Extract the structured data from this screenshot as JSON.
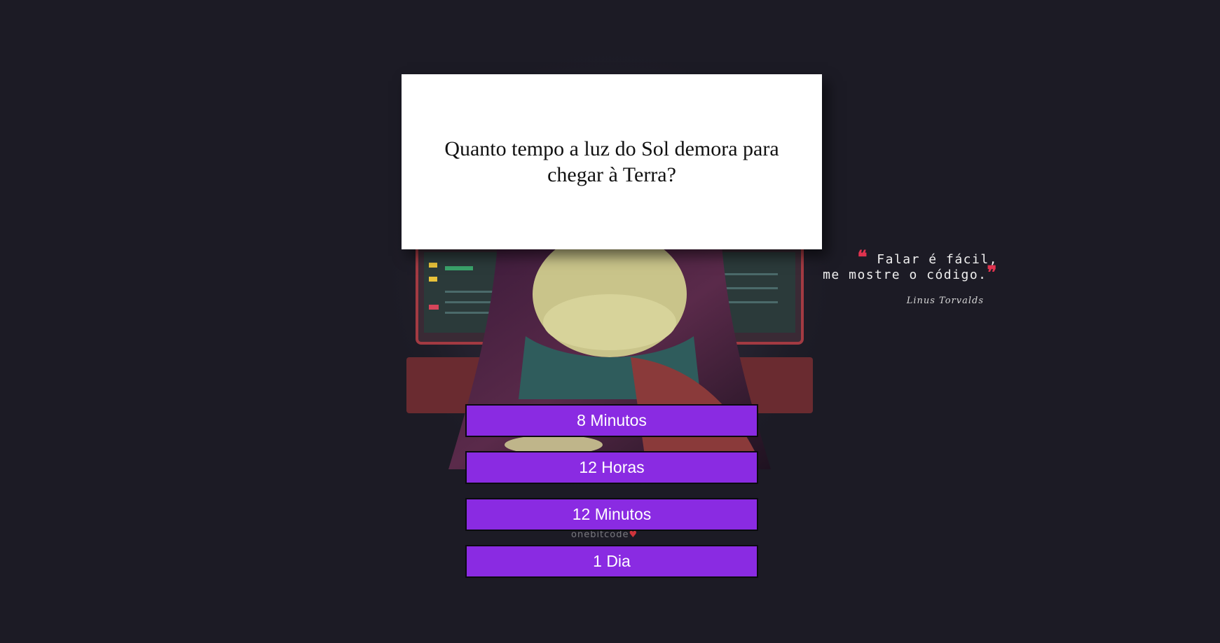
{
  "question": {
    "text": "Quanto tempo a luz do Sol demora para chegar à Terra?"
  },
  "answers": [
    {
      "label": "8 Minutos"
    },
    {
      "label": "12 Horas"
    },
    {
      "label": "12 Minutos"
    },
    {
      "label": "1 Dia"
    }
  ],
  "quote": {
    "open_mark": "❝",
    "text_line1": "Falar é fácil,",
    "text_line2": "me mostre o código.",
    "close_mark": "❞",
    "author": "Linus Torvalds"
  },
  "watermark": {
    "text": "onebitcode",
    "heart": "♥"
  },
  "colors": {
    "background": "#1c1b25",
    "answer_button": "#8a2be2",
    "quote_mark": "#e0334f"
  }
}
